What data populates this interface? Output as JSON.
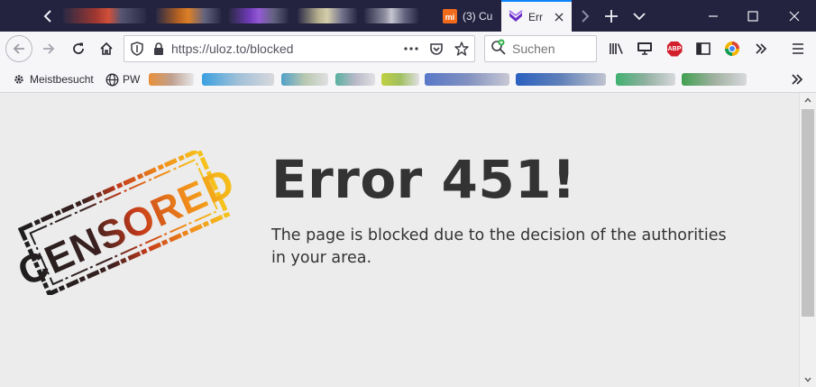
{
  "browser": {
    "tabs": [
      {
        "title": "(3) Cu",
        "favicon": "orange-mi-icon",
        "active": false
      },
      {
        "title": "Err",
        "favicon": "purple-chevron-icon",
        "active": true
      }
    ],
    "url": "https://uloz.to/blocked",
    "search_placeholder": "Suchen",
    "bookmarks": [
      {
        "label": "Meistbesucht",
        "icon": "gear-icon"
      },
      {
        "label": "PW",
        "icon": "globe-icon"
      }
    ]
  },
  "page": {
    "stamp_text": "CENSORED",
    "title": "Error 451!",
    "description": "The page is blocked due to the decision of the authorities in your area."
  },
  "colors": {
    "titlebar": "#23223f",
    "toolbar": "#f6f6f8",
    "content_bg": "#ececec",
    "text": "#333333",
    "accent": "#0a84ff"
  }
}
